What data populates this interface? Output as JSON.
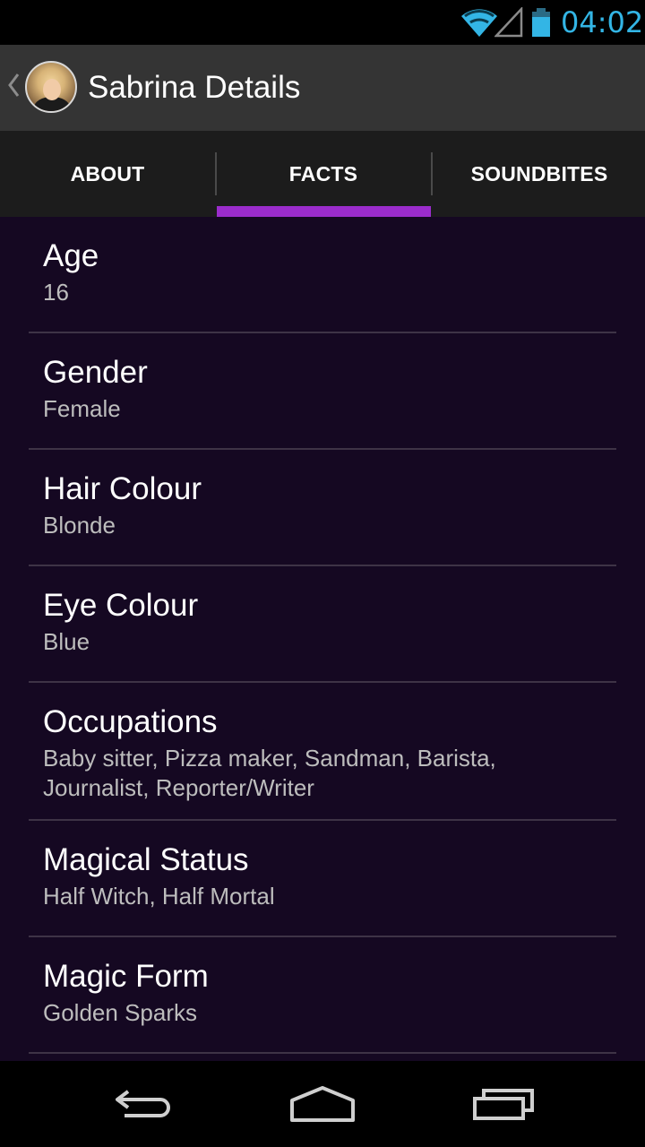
{
  "status_bar": {
    "time": "04:02",
    "icons": [
      "wifi-icon",
      "signal-icon",
      "battery-icon"
    ],
    "accent_color": "#33b5e5"
  },
  "action_bar": {
    "title": "Sabrina Details",
    "icons": [
      "back-chevron-icon",
      "avatar"
    ]
  },
  "tabs": [
    {
      "label": "ABOUT",
      "selected": false
    },
    {
      "label": "FACTS",
      "selected": true
    },
    {
      "label": "SOUNDBITES",
      "selected": false
    }
  ],
  "tab_indicator_color": "#9b2ccc",
  "facts": [
    {
      "label": "Age",
      "value": "16"
    },
    {
      "label": "Gender",
      "value": "Female"
    },
    {
      "label": "Hair Colour",
      "value": "Blonde"
    },
    {
      "label": "Eye Colour",
      "value": "Blue"
    },
    {
      "label": "Occupations",
      "value": "Baby sitter, Pizza maker, Sandman, Barista, Journalist, Reporter/Writer"
    },
    {
      "label": "Magical Status",
      "value": "Half Witch, Half Mortal"
    },
    {
      "label": "Magic Form",
      "value": "Golden Sparks"
    }
  ],
  "nav_bar": {
    "icons": [
      "back-icon",
      "home-icon",
      "recents-icon"
    ]
  }
}
